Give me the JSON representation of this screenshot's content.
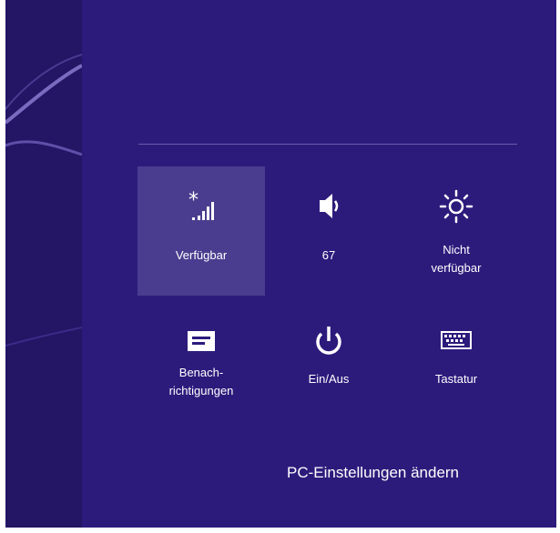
{
  "settings_charm": {
    "tiles": [
      {
        "label": "Verfügbar",
        "icon": "network-signal-icon",
        "selected": true
      },
      {
        "label": "67",
        "icon": "volume-icon"
      },
      {
        "label": "Nicht\nverfügbar",
        "icon": "brightness-icon"
      },
      {
        "label": "Benach-\nrichtigungen",
        "icon": "notifications-icon"
      },
      {
        "label": "Ein/Aus",
        "icon": "power-icon"
      },
      {
        "label": "Tastatur",
        "icon": "keyboard-icon"
      }
    ],
    "change_pc_settings": "PC-Einstellungen ändern"
  },
  "colors": {
    "panel": "#2d1b7c",
    "selected_tile": "#4a3d8f",
    "text": "#ffffff"
  }
}
